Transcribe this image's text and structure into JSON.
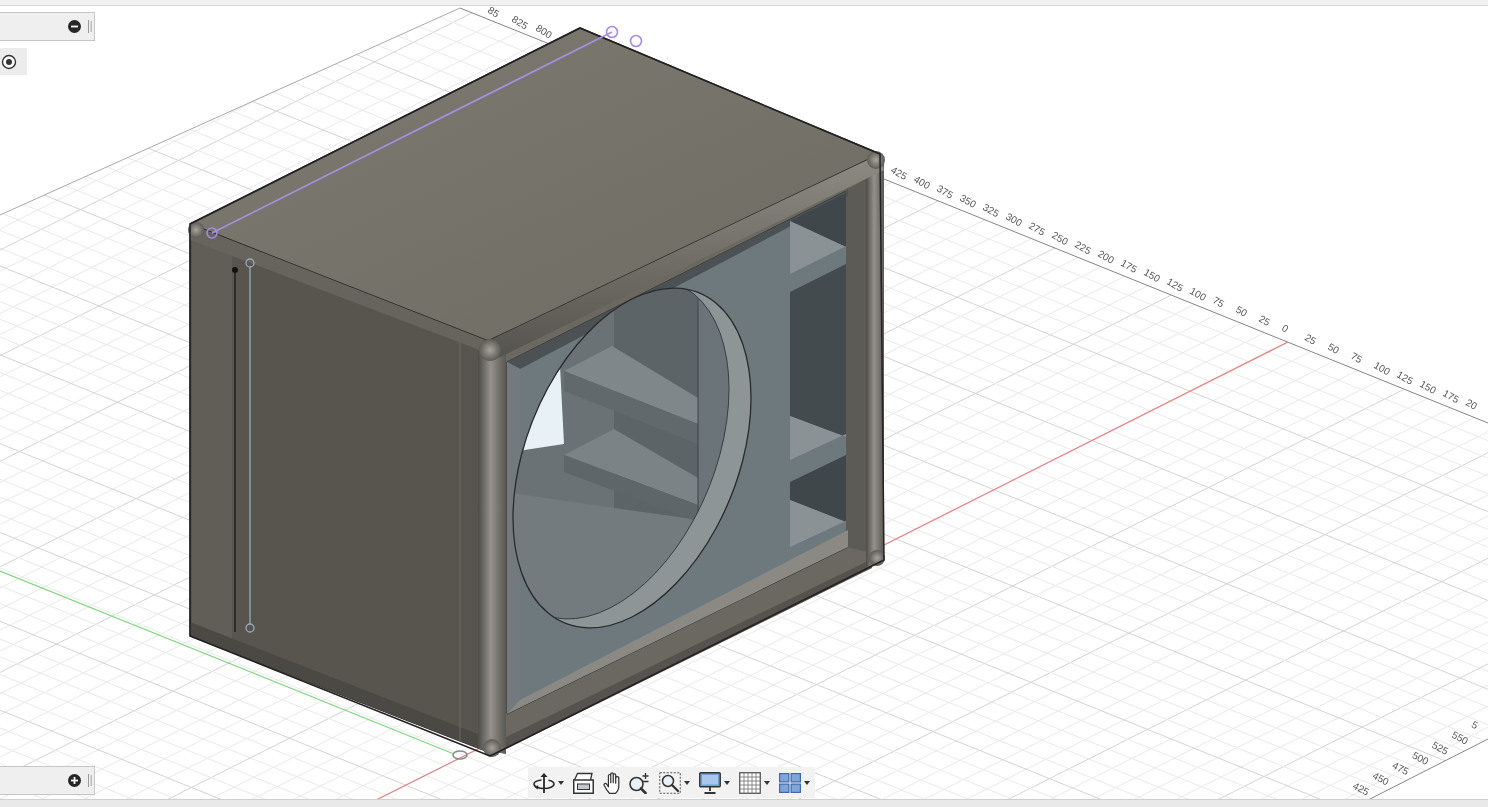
{
  "panels": [
    {
      "expanded": true
    },
    {
      "expanded": false
    }
  ],
  "rulers": [
    {
      "labels": [
        "85",
        "825",
        "800"
      ]
    },
    {
      "labels": [
        "425",
        "400",
        "375",
        "350",
        "325",
        "300",
        "275",
        "250",
        "225",
        "200",
        "175",
        "150",
        "125",
        "100",
        "75",
        "50",
        "25",
        "0",
        "25",
        "50",
        "75",
        "100",
        "125",
        "150",
        "175",
        "20"
      ]
    },
    {
      "labels": [
        "425",
        "450",
        "475",
        "500",
        "525",
        "550",
        "5"
      ]
    }
  ],
  "toolbar": {
    "tools": [
      {
        "kind": "orbit",
        "menu": true
      },
      {
        "kind": "look",
        "menu": false
      },
      {
        "kind": "pan",
        "menu": false
      },
      {
        "kind": "zoom",
        "menu": false
      },
      {
        "kind": "fit",
        "menu": true
      },
      {
        "kind": "display",
        "menu": true
      },
      {
        "kind": "grid",
        "menu": true
      },
      {
        "kind": "viewports",
        "menu": true
      }
    ]
  }
}
